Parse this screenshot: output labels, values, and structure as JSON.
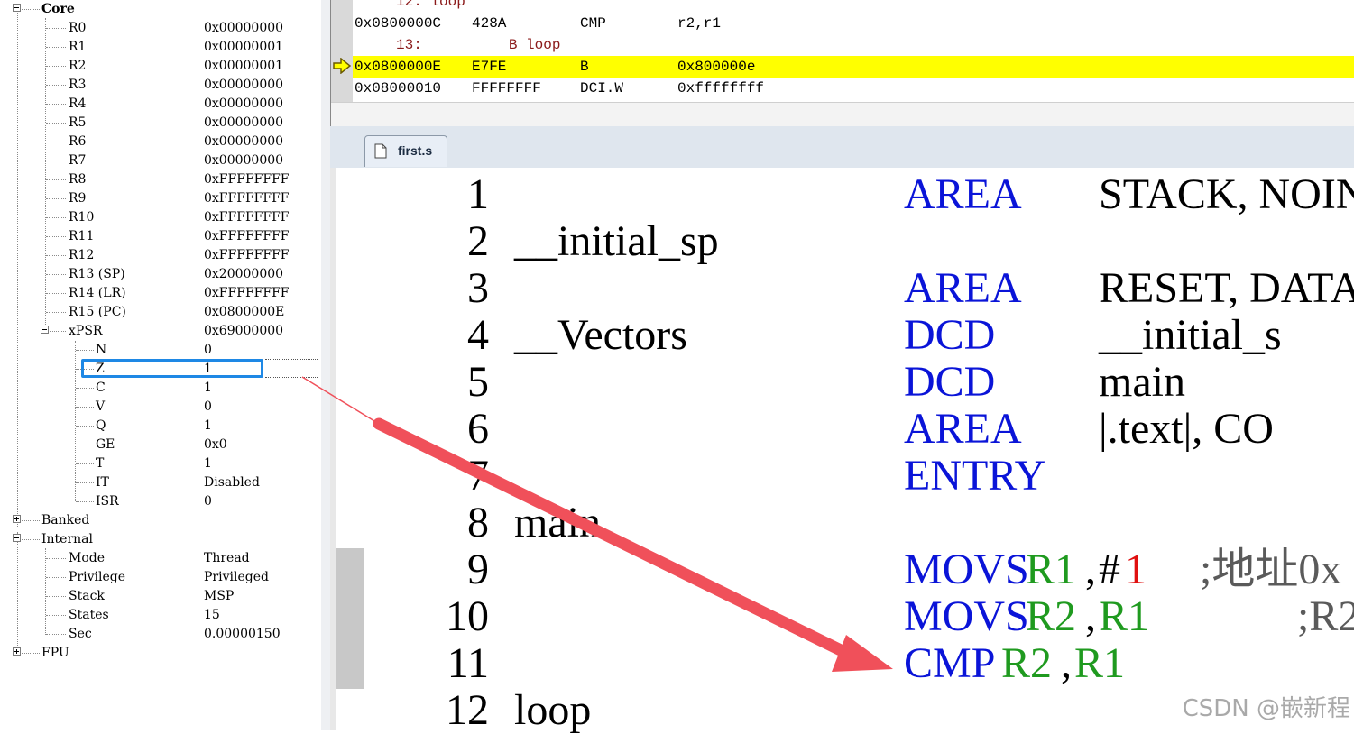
{
  "registers": {
    "groups": {
      "core": "Core",
      "banked": "Banked",
      "internal": "Internal",
      "fpu": "FPU"
    },
    "core_regs": [
      {
        "name": "R0",
        "value": "0x00000000"
      },
      {
        "name": "R1",
        "value": "0x00000001"
      },
      {
        "name": "R2",
        "value": "0x00000001"
      },
      {
        "name": "R3",
        "value": "0x00000000"
      },
      {
        "name": "R4",
        "value": "0x00000000"
      },
      {
        "name": "R5",
        "value": "0x00000000"
      },
      {
        "name": "R6",
        "value": "0x00000000"
      },
      {
        "name": "R7",
        "value": "0x00000000"
      },
      {
        "name": "R8",
        "value": "0xFFFFFFFF"
      },
      {
        "name": "R9",
        "value": "0xFFFFFFFF"
      },
      {
        "name": "R10",
        "value": "0xFFFFFFFF"
      },
      {
        "name": "R11",
        "value": "0xFFFFFFFF"
      },
      {
        "name": "R12",
        "value": "0xFFFFFFFF"
      },
      {
        "name": "R13 (SP)",
        "value": "0x20000000"
      },
      {
        "name": "R14 (LR)",
        "value": "0xFFFFFFFF"
      },
      {
        "name": "R15 (PC)",
        "value": "0x0800000E"
      }
    ],
    "xpsr": {
      "name": "xPSR",
      "value": "0x69000000"
    },
    "flags": [
      {
        "name": "N",
        "value": "0"
      },
      {
        "name": "Z",
        "value": "1"
      },
      {
        "name": "C",
        "value": "1"
      },
      {
        "name": "V",
        "value": "0"
      },
      {
        "name": "Q",
        "value": "1"
      },
      {
        "name": "GE",
        "value": "0x0"
      },
      {
        "name": "T",
        "value": "1"
      },
      {
        "name": "IT",
        "value": "Disabled"
      },
      {
        "name": "ISR",
        "value": "0"
      }
    ],
    "internal": [
      {
        "name": "Mode",
        "value": "Thread"
      },
      {
        "name": "Privilege",
        "value": "Privileged"
      },
      {
        "name": "Stack",
        "value": "MSP"
      },
      {
        "name": "States",
        "value": "15"
      },
      {
        "name": "Sec",
        "value": "0.00000150"
      }
    ],
    "highlighted_flag": "Z"
  },
  "disassembly": {
    "rows": [
      {
        "type": "src",
        "text": "12: loop"
      },
      {
        "type": "ins",
        "addr": "0x0800000C",
        "code": "428A",
        "mnem": "CMP",
        "ops": "r2,r1"
      },
      {
        "type": "src",
        "text": "13:          B loop"
      },
      {
        "type": "ins",
        "addr": "0x0800000E",
        "code": "E7FE",
        "mnem": "B",
        "ops": "0x800000e",
        "current": true
      },
      {
        "type": "ins",
        "addr": "0x08000010",
        "code": "FFFFFFFF",
        "mnem": "DCI.W",
        "ops": "0xffffffff"
      }
    ],
    "current_marker": "current-instruction-arrow-icon"
  },
  "tabs": [
    {
      "label": "first.s",
      "icon": "document-icon",
      "active": true
    }
  ],
  "editor": {
    "lines": [
      {
        "n": "1",
        "label": "",
        "op": "AREA",
        "arg": "STACK, NOIN"
      },
      {
        "n": "2",
        "label": "__initial_sp",
        "op": "",
        "arg": ""
      },
      {
        "n": "3",
        "label": "",
        "op": "AREA",
        "arg": "RESET, DATA"
      },
      {
        "n": "4",
        "label": "__Vectors",
        "op": "DCD",
        "arg": "__initial_s"
      },
      {
        "n": "5",
        "label": "",
        "op": "DCD",
        "arg": "main"
      },
      {
        "n": "6",
        "label": "",
        "op": "AREA",
        "arg": "|.text|, CO"
      },
      {
        "n": "7",
        "label": "",
        "op": "ENTRY",
        "arg": ""
      },
      {
        "n": "8",
        "label": "main",
        "op": "",
        "arg": ""
      },
      {
        "n": "9",
        "label": "",
        "op": "MOVS",
        "r": "R1",
        "sep": ",",
        "imm_hash": "#",
        "imm": "1",
        "comment": ";地址0x"
      },
      {
        "n": "10",
        "label": "",
        "op": "MOVS",
        "r": "R2",
        "sep": ",",
        "r2": "R1",
        "comment": ";R2"
      },
      {
        "n": "11",
        "label": "",
        "op": "CMP",
        "r": "R2",
        "sep": ",",
        "r2": "R1"
      },
      {
        "n": "12",
        "label": "loop",
        "op": "",
        "arg": ""
      }
    ]
  },
  "colors": {
    "keyword": "#0a14d8",
    "register": "#1f9a1f",
    "immediate": "#e01010",
    "current_line": "#ffff00",
    "highlight_box": "#1e88e5",
    "arrow": "#f0505a"
  },
  "watermark": "CSDN @嵌新程"
}
